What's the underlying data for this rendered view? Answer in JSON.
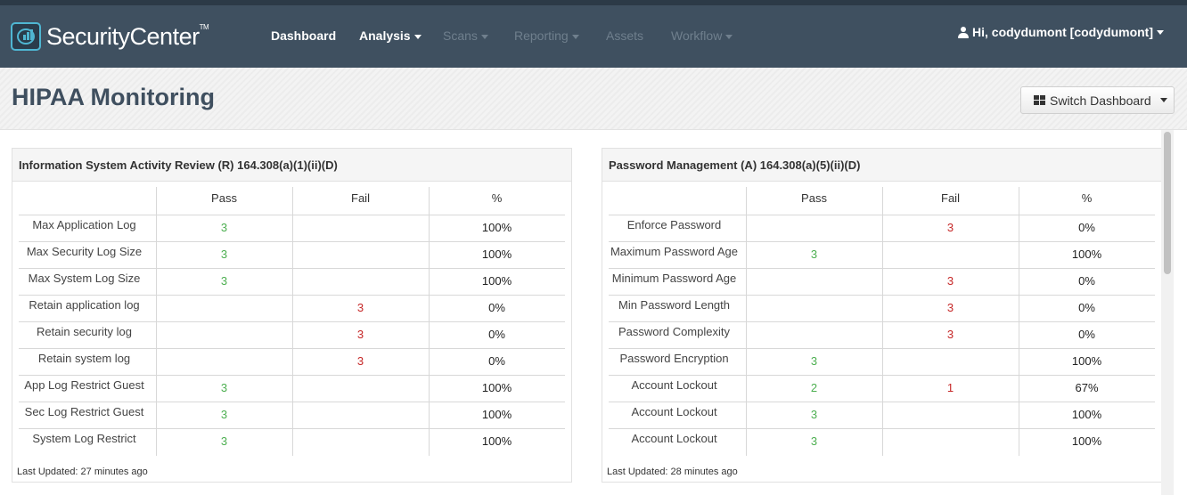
{
  "app": {
    "logo_text": "SecurityCenter",
    "logo_mark": "TM"
  },
  "nav": {
    "items": [
      {
        "label": "Dashboard",
        "dropdown": false,
        "enabled": true
      },
      {
        "label": "Analysis",
        "dropdown": true,
        "enabled": true
      },
      {
        "label": "Scans",
        "dropdown": true,
        "enabled": false
      },
      {
        "label": "Reporting",
        "dropdown": true,
        "enabled": false
      },
      {
        "label": "Assets",
        "dropdown": false,
        "enabled": false
      },
      {
        "label": "Workflow",
        "dropdown": true,
        "enabled": false
      }
    ],
    "user_greeting": "Hi, codydumont [codydumont]",
    "user_icon": "user-icon"
  },
  "page": {
    "title": "HIPAA Monitoring",
    "switch_dashboard_label": "Switch Dashboard",
    "switch_icon": "grid-icon"
  },
  "colors": {
    "navbar": "#3f5060",
    "pass": "#4caf50",
    "fail": "#c62828",
    "logo_accent": "#4fb6d2"
  },
  "panels": [
    {
      "title": "Information System Activity Review (R) 164.308(a)(1)(ii)(D)",
      "columns": [
        "",
        "Pass",
        "Fail",
        "%"
      ],
      "rows": [
        {
          "label": "Max Application Log",
          "pass": "3",
          "fail": "",
          "pct": "100%"
        },
        {
          "label": "Max Security Log Size",
          "pass": "3",
          "fail": "",
          "pct": "100%"
        },
        {
          "label": "Max System Log Size",
          "pass": "3",
          "fail": "",
          "pct": "100%"
        },
        {
          "label": "Retain application log",
          "pass": "",
          "fail": "3",
          "pct": "0%"
        },
        {
          "label": "Retain security log",
          "pass": "",
          "fail": "3",
          "pct": "0%"
        },
        {
          "label": "Retain system log",
          "pass": "",
          "fail": "3",
          "pct": "0%"
        },
        {
          "label": "App Log Restrict Guest",
          "pass": "3",
          "fail": "",
          "pct": "100%"
        },
        {
          "label": "Sec Log Restrict Guest",
          "pass": "3",
          "fail": "",
          "pct": "100%"
        },
        {
          "label": "System Log Restrict",
          "pass": "3",
          "fail": "",
          "pct": "100%"
        }
      ],
      "last_updated": "Last Updated: 27 minutes ago"
    },
    {
      "title": "Password Management (A) 164.308(a)(5)(ii)(D)",
      "columns": [
        "",
        "Pass",
        "Fail",
        "%"
      ],
      "rows": [
        {
          "label": "Enforce Password",
          "pass": "",
          "fail": "3",
          "pct": "0%"
        },
        {
          "label": "Maximum Password Age",
          "pass": "3",
          "fail": "",
          "pct": "100%"
        },
        {
          "label": "Minimum Password Age",
          "pass": "",
          "fail": "3",
          "pct": "0%"
        },
        {
          "label": "Min Password Length",
          "pass": "",
          "fail": "3",
          "pct": "0%"
        },
        {
          "label": "Password Complexity",
          "pass": "",
          "fail": "3",
          "pct": "0%"
        },
        {
          "label": "Password Encryption",
          "pass": "3",
          "fail": "",
          "pct": "100%"
        },
        {
          "label": "Account Lockout",
          "pass": "2",
          "fail": "1",
          "pct": "67%"
        },
        {
          "label": "Account Lockout",
          "pass": "3",
          "fail": "",
          "pct": "100%"
        },
        {
          "label": "Account Lockout",
          "pass": "3",
          "fail": "",
          "pct": "100%"
        }
      ],
      "last_updated": "Last Updated: 28 minutes ago"
    }
  ]
}
